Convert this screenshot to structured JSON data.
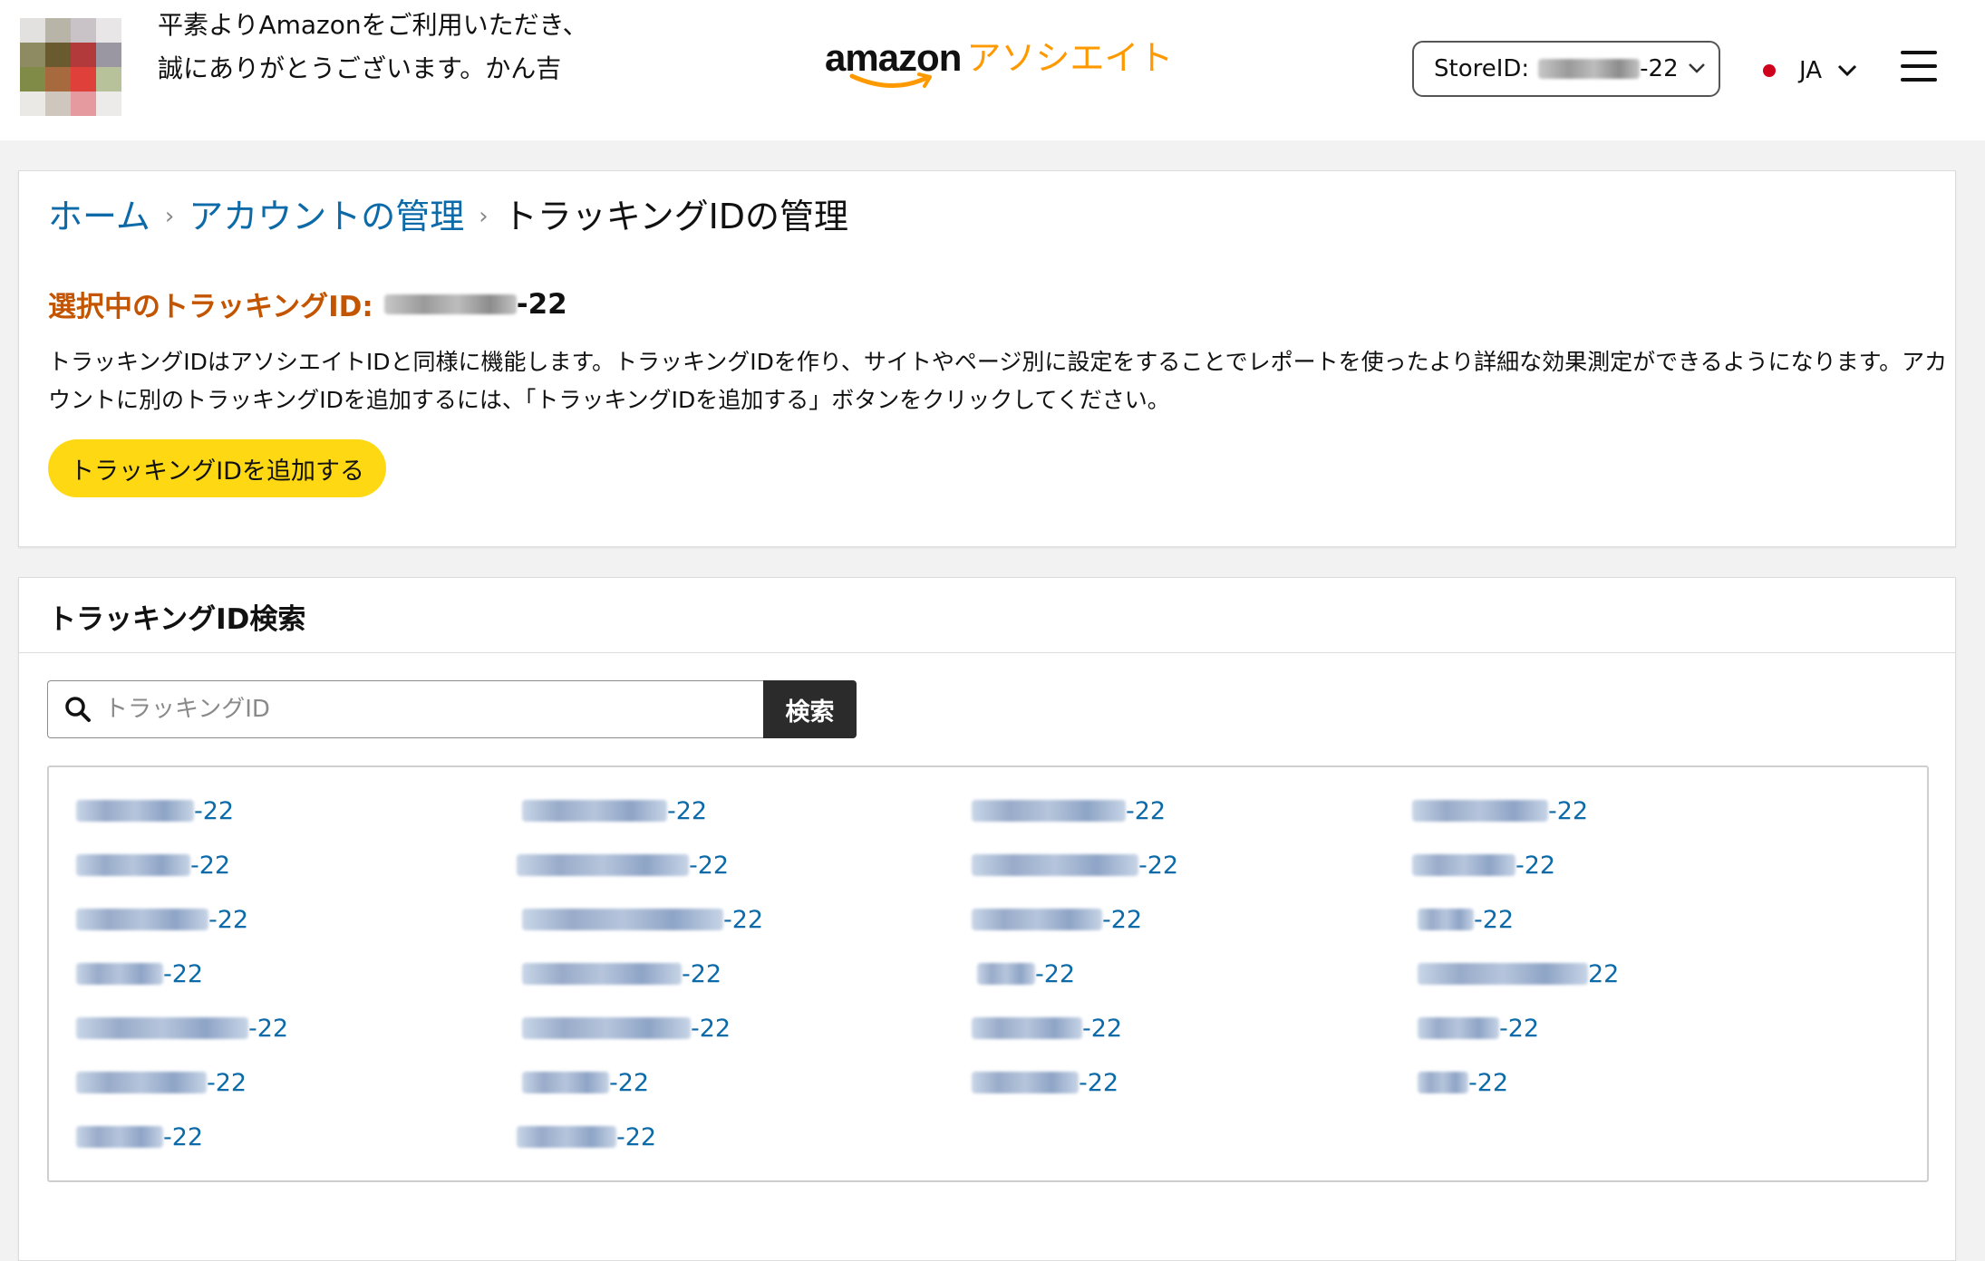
{
  "header": {
    "greeting": "平素よりAmazonをご利用いただき、誠にありがとうございます。かん吉",
    "logo_brand": "amazon",
    "logo_suffix": "アソシエイト",
    "store_label": "StoreID:",
    "store_suffix": "-22",
    "language": "JA",
    "brand_color": "#ff9900",
    "flag_color": "#d0021b"
  },
  "breadcrumb": {
    "home": "ホーム",
    "account": "アカウントの管理",
    "current": "トラッキングIDの管理"
  },
  "selected": {
    "label": "選択中のトラッキングID:",
    "suffix": "-22"
  },
  "description": "トラッキングIDはアソシエイトIDと同様に機能します。トラッキングIDを作り、サイトやページ別に設定をすることでレポートを使ったより詳細な効果測定ができるようになります。アカウントに別のトラッキングIDを追加するには、「トラッキングIDを追加する」ボタンをクリックしてください。",
  "add_button_label": "トラッキングIDを追加する",
  "search": {
    "heading": "トラッキングID検索",
    "placeholder": "トラッキングID",
    "button_label": "検索"
  },
  "tracking_ids": {
    "columns": [
      [
        "-22",
        "-22",
        "-22",
        "-22",
        "-22",
        "-22",
        "-22"
      ],
      [
        "-22",
        "-22",
        "-22",
        "-22",
        "-22",
        "-22",
        "-22"
      ],
      [
        "-22",
        "-22",
        "-22",
        "-22",
        "-22",
        "-22"
      ],
      [
        "-22",
        "-22",
        "-22",
        "22",
        "-22",
        "-22"
      ]
    ]
  }
}
